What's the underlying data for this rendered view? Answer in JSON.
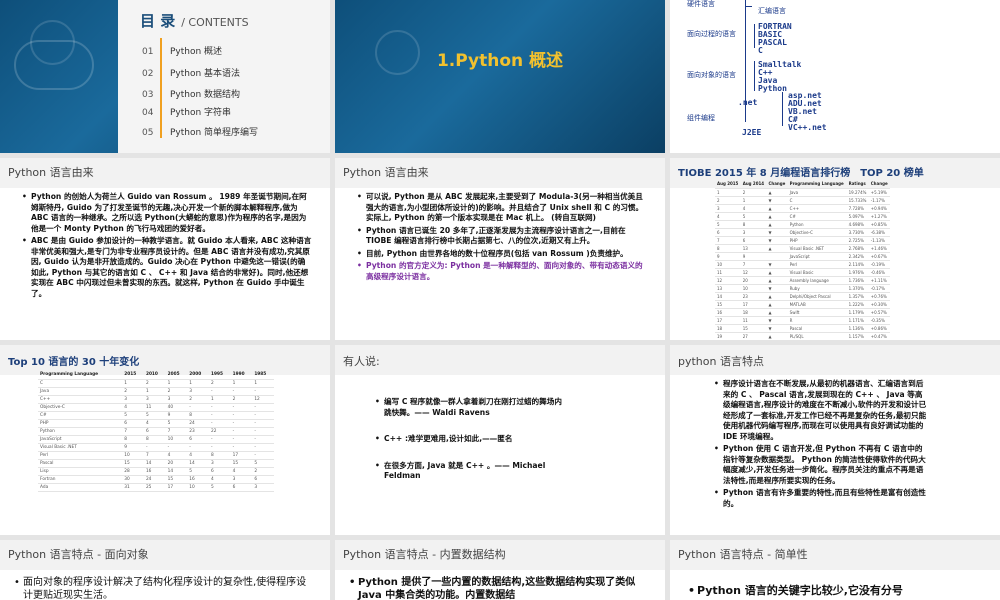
{
  "slides": {
    "s1": {
      "title": "目 录",
      "subtitle": "/ CONTENTS",
      "items": [
        {
          "num": "01",
          "label": "Python 概述"
        },
        {
          "num": "02",
          "label": "Python 基本语法"
        },
        {
          "num": "03",
          "label": "Python 数据结构"
        },
        {
          "num": "04",
          "label": "Python 字符串"
        },
        {
          "num": "05",
          "label": "Python 简单程序编写"
        }
      ]
    },
    "s2": {
      "title": "1.Python 概述"
    },
    "s3": {
      "cat_hardware": "硬件语言",
      "cat_asm": "汇编语言",
      "cat_procedural": "面向过程的语言",
      "procedural": [
        "FORTRAN",
        "BASIC",
        "PASCAL",
        "C"
      ],
      "cat_oo": "面向对象的语言",
      "oo": [
        "Smalltalk",
        "C++",
        "Java",
        "Python"
      ],
      "net_label": ".net",
      "net": [
        "asp.net",
        "ADU.net",
        "VB.net",
        "C#",
        "VC++.net"
      ],
      "cat_component": "组件编程",
      "j2ee": "J2EE"
    },
    "s4": {
      "header": "Python 语言由来",
      "bullets": [
        "Python 的创始人为荷兰人 Guido van Rossum 。 1989 年圣诞节期间,在阿姆斯特丹, Guido 为了打发圣诞节的无趣,决心开发一个新的脚本解释程序,做为 ABC 语言的一种继承。之所以选 Python(大蟒蛇的意思)作为程序的名字,是因为他是一个 Monty Python 的飞行马戏团的爱好者。",
        "ABC 是由 Guido 参加设计的一种教学语言。就 Guido 本人看来, ABC 这种语言非常优美和强大,是专门为非专业程序员设计的。但是 ABC 语言并没有成功,究其原因, Guido 认为是非开放造成的。Guido 决心在 Python 中避免这一错误(的确如此, Python 与其它的语言如 C 、 C++ 和 Java 结合的非常好)。同时,他还想实现在 ABC 中闪现过但未曾实现的东西。就这样, Python 在 Guido 手中诞生了。"
      ]
    },
    "s5": {
      "header": "Python 语言由来",
      "bullets": [
        "可以说, Python 是从 ABC 发展起来,主要受到了 Modula-3(另一种相当优美且强大的语言,为小型团体所设计的)的影响。并且结合了 Unix shell 和 C 的习惯。实际上, Python 的第一个版本实现是在 Mac 机上。 (转自互联网)",
        "Python 语言已诞生 20 多年了,正逐渐发展为主流程序设计语言之一,目前在 TIOBE 编程语言排行榜中长期占据第七、八的位次,近期又有上升。",
        "目前, Python 由世界各地的数十位程序员(包括 van Rossum )负责维护。",
        "Python 的官方定义为: Python 是一种解释型的、面向对象的、带有动态语义的高级程序设计语言。"
      ]
    },
    "s6": {
      "header": "TIOBE 2015 年 8 月编程语言排行榜　TOP 20 榜单",
      "columns": [
        "Aug 2015",
        "Aug 2014",
        "Change",
        "Programming Language",
        "Ratings",
        "Change"
      ],
      "rows": [
        [
          "1",
          "2",
          "▲",
          "Java",
          "19.274%",
          "+5.19%"
        ],
        [
          "2",
          "1",
          "▼",
          "C",
          "15.733%",
          "-1.17%"
        ],
        [
          "3",
          "4",
          "▲",
          "C++",
          "7.728%",
          "+0.94%"
        ],
        [
          "4",
          "5",
          "▲",
          "C#",
          "5.097%",
          "+1.27%"
        ],
        [
          "5",
          "8",
          "▲",
          "Python",
          "4.698%",
          "+0.85%"
        ],
        [
          "6",
          "3",
          "▼",
          "Objective-C",
          "3.730%",
          "-6.38%"
        ],
        [
          "7",
          "6",
          "▼",
          "PHP",
          "2.725%",
          "-1.13%"
        ],
        [
          "8",
          "13",
          "▲",
          "Visual Basic .NET",
          "2.768%",
          "+1.46%"
        ],
        [
          "9",
          "9",
          "",
          "JavaScript",
          "2.342%",
          "+0.67%"
        ],
        [
          "10",
          "7",
          "▼",
          "Perl",
          "2.114%",
          "-0.19%"
        ],
        [
          "11",
          "12",
          "▲",
          "Visual Basic",
          "1.976%",
          "-0.46%"
        ],
        [
          "12",
          "20",
          "▲",
          "Assembly language",
          "1.736%",
          "+1.11%"
        ],
        [
          "13",
          "10",
          "▼",
          "Ruby",
          "1.370%",
          "-0.17%"
        ],
        [
          "14",
          "23",
          "▲",
          "Delphi/Object Pascal",
          "1.357%",
          "+0.76%"
        ],
        [
          "15",
          "17",
          "▲",
          "MATLAB",
          "1.222%",
          "+0.30%"
        ],
        [
          "16",
          "18",
          "▲",
          "Swift",
          "1.179%",
          "+0.57%"
        ],
        [
          "17",
          "11",
          "▼",
          "R",
          "1.171%",
          "-0.35%"
        ],
        [
          "18",
          "15",
          "▼",
          "Pascal",
          "1.136%",
          "+0.86%"
        ],
        [
          "19",
          "27",
          "▲",
          "PL/SQL",
          "1.157%",
          "+0.47%"
        ],
        [
          "20",
          "29",
          "▲",
          "D",
          "1.122%",
          "+0.65%"
        ]
      ]
    },
    "s7": {
      "header": "Top 10 语言的 30 十年变化",
      "columns": [
        "Programming Language",
        "2015",
        "2010",
        "2005",
        "2000",
        "1995",
        "1990",
        "1985"
      ],
      "rows": [
        [
          "C",
          "1",
          "2",
          "1",
          "1",
          "2",
          "1",
          "1"
        ],
        [
          "Java",
          "2",
          "1",
          "2",
          "3",
          "-",
          "-",
          "-"
        ],
        [
          "C++",
          "3",
          "3",
          "3",
          "2",
          "1",
          "2",
          "12"
        ],
        [
          "Objective-C",
          "4",
          "11",
          "40",
          "-",
          "-",
          "-",
          "-"
        ],
        [
          "C#",
          "5",
          "5",
          "9",
          "8",
          "-",
          "-",
          "-"
        ],
        [
          "PHP",
          "6",
          "4",
          "5",
          "24",
          "-",
          "-",
          "-"
        ],
        [
          "Python",
          "7",
          "6",
          "7",
          "23",
          "22",
          "-",
          "-"
        ],
        [
          "JavaScript",
          "8",
          "8",
          "10",
          "6",
          "-",
          "-",
          "-"
        ],
        [
          "Visual Basic .NET",
          "9",
          "-",
          "-",
          "-",
          "-",
          "-",
          "-"
        ],
        [
          "Perl",
          "10",
          "7",
          "4",
          "4",
          "8",
          "17",
          "-"
        ],
        [
          "Pascal",
          "15",
          "14",
          "20",
          "14",
          "3",
          "15",
          "5"
        ],
        [
          "Lisp",
          "28",
          "16",
          "14",
          "5",
          "6",
          "4",
          "2"
        ],
        [
          "Fortran",
          "30",
          "24",
          "15",
          "16",
          "4",
          "3",
          "6"
        ],
        [
          "Ada",
          "31",
          "25",
          "17",
          "10",
          "5",
          "6",
          "3"
        ]
      ]
    },
    "s8": {
      "header": "有人说:",
      "bullets": [
        "编写 C 程序就像一群人拿着剃刀在刚打过蜡的舞场内跳快舞。—— Waldi Ravens",
        "C++ :难学更难用,设计如此,——匿名",
        "在很多方面, Java 就是 C++ 。—— Michael Feldman"
      ]
    },
    "s9": {
      "header": "python 语言特点",
      "bullets": [
        "程序设计语言在不断发展,从最初的机器语言、汇编语言到后来的 C 、 Pascal 语言,发展到现在的 C++ 、 Java 等高级编程语言,程序设计的难度在不断减小,软件的开发和设计已经形成了一套标准,开发工作已经不再是复杂的任务,最初只能使用机器代码编写程序,而现在可以使用具有良好调试功能的 IDE 环境编程。",
        "Python 使用 C 语言开发,但 Python 不再有 C 语言中的指针等复杂数据类型。 Python 的简洁性使得软件的代码大幅度减少,开发任务进一步简化。程序员关注的重点不再是语法特性,而是程序所要实现的任务。",
        "Python 语言有许多重要的特性,而且有些特性是富有创造性的。"
      ]
    },
    "s10": {
      "header": "Python 语言特点 - 面向对象",
      "bullets": [
        "面向对象的程序设计解决了结构化程序设计的复杂性,使得程序设计更贴近现实生活。"
      ]
    },
    "s11": {
      "header": "Python 语言特点 - 内置数据结构",
      "bullets": [
        "Python 提供了一些内置的数据结构,这些数据结构实现了类似 Java 中集合类的功能。内置数据结"
      ]
    },
    "s12": {
      "header": "Python 语言特点 - 简单性",
      "bullets": [
        "Python 语言的关键字比较少,它没有分号"
      ]
    }
  }
}
